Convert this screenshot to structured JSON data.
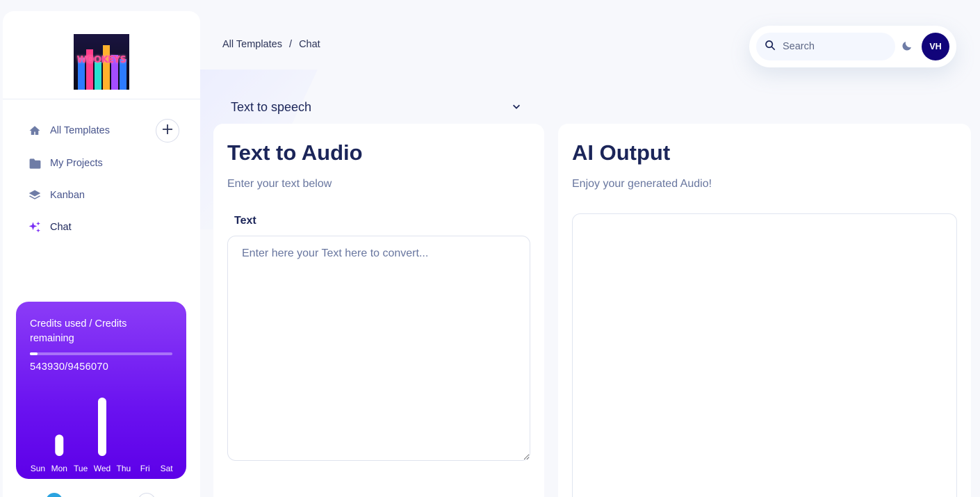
{
  "brand": {
    "logo_text": "WOOKEYS"
  },
  "sidebar": {
    "items": [
      {
        "label": "All Templates",
        "icon": "home-icon"
      },
      {
        "label": "My Projects",
        "icon": "folder-icon"
      },
      {
        "label": "Kanban",
        "icon": "layers-icon"
      },
      {
        "label": "Chat",
        "icon": "sparkles-icon",
        "active": true
      }
    ],
    "add_icon": "plus-icon"
  },
  "credits": {
    "title": "Credits used / Credits remaining",
    "count": "543930/9456070",
    "progress_fraction": 0.0544,
    "chart_data": {
      "type": "bar",
      "categories": [
        "Sun",
        "Mon",
        "Tue",
        "Wed",
        "Thu",
        "Fri",
        "Sat"
      ],
      "values": [
        0,
        30,
        0,
        82,
        0,
        0,
        0
      ],
      "title": "",
      "xlabel": "",
      "ylabel": "",
      "grid": false
    }
  },
  "breadcrumb": {
    "root": "All Templates",
    "separator": "/",
    "current": "Chat"
  },
  "topbar": {
    "search_placeholder": "Search",
    "theme_icon": "moon-icon",
    "avatar_initials": "VH"
  },
  "tool_select": {
    "selected": "Text to speech"
  },
  "left_panel": {
    "title": "Text to Audio",
    "subtitle": "Enter your text below",
    "field_label": "Text",
    "textarea_placeholder": "Enter here your Text here to convert..."
  },
  "right_panel": {
    "title": "AI Output",
    "subtitle": "Enjoy your generated Audio!"
  },
  "colors": {
    "accent": "#7a2ff5",
    "avatar_bg": "#11047a",
    "heading": "#1b2559"
  }
}
